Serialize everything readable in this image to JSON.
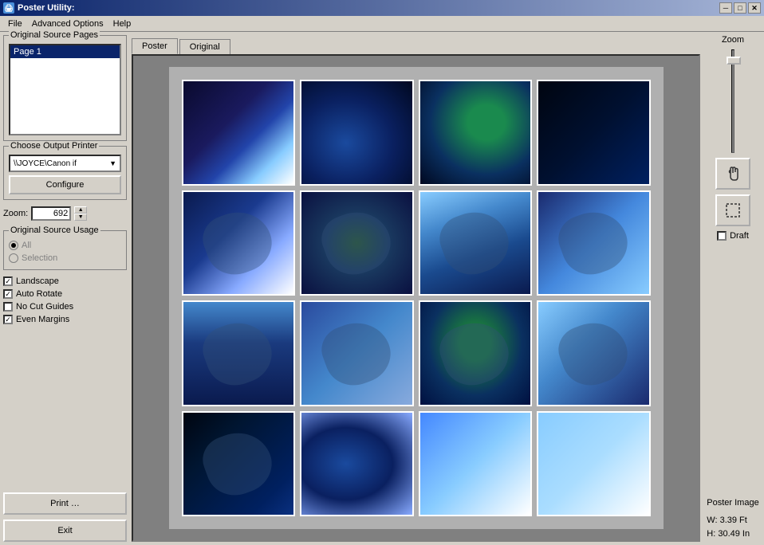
{
  "window": {
    "title": "Poster Utility:",
    "icon": "🖨"
  },
  "titlebar": {
    "minimize": "─",
    "maximize": "□",
    "close": "✕"
  },
  "menubar": {
    "items": [
      {
        "id": "file",
        "label": "File"
      },
      {
        "id": "advanced-options",
        "label": "Advanced Options"
      },
      {
        "id": "help",
        "label": "Help"
      }
    ]
  },
  "left_panel": {
    "source_pages_group": {
      "title": "Original Source Pages",
      "pages": [
        {
          "label": "Page 1",
          "selected": true
        }
      ]
    },
    "output_printer_group": {
      "title": "Choose Output Printer",
      "printer_value": "\\\\JOYCE\\Canon if",
      "configure_label": "Configure"
    },
    "zoom_row": {
      "label": "Zoom:",
      "value": "692"
    },
    "source_usage_group": {
      "title": "Original Source Usage",
      "options": [
        {
          "label": "All",
          "checked": true,
          "enabled": false
        },
        {
          "label": "Selection",
          "checked": false,
          "enabled": false
        }
      ]
    },
    "checkboxes": [
      {
        "id": "landscape",
        "label": "Landscape",
        "checked": true
      },
      {
        "id": "auto-rotate",
        "label": "Auto Rotate",
        "checked": true
      },
      {
        "id": "no-cut-guides",
        "label": "No Cut Guides",
        "checked": false
      },
      {
        "id": "even-margins",
        "label": "Even Margins",
        "checked": true
      }
    ],
    "print_label": "Print …",
    "exit_label": "Exit"
  },
  "tabs": [
    {
      "id": "poster",
      "label": "Poster",
      "active": true
    },
    {
      "id": "original",
      "label": "Original",
      "active": false
    }
  ],
  "right_panel": {
    "zoom_label": "Zoom",
    "draft_label": "Draft",
    "poster_image_label": "Poster Image",
    "width_label": "W: 3.39 Ft",
    "height_label": "H: 30.49 In"
  },
  "poster_grid": {
    "rows": 4,
    "cols": 4,
    "cells": [
      {
        "id": 1,
        "class": "img-1"
      },
      {
        "id": 2,
        "class": "img-2"
      },
      {
        "id": 3,
        "class": "img-3"
      },
      {
        "id": 4,
        "class": "img-4"
      },
      {
        "id": 5,
        "class": "img-5"
      },
      {
        "id": 6,
        "class": "img-6"
      },
      {
        "id": 7,
        "class": "img-7"
      },
      {
        "id": 8,
        "class": "img-8"
      },
      {
        "id": 9,
        "class": "img-9"
      },
      {
        "id": 10,
        "class": "img-10"
      },
      {
        "id": 11,
        "class": "img-11"
      },
      {
        "id": 12,
        "class": "img-12"
      },
      {
        "id": 13,
        "class": "img-13"
      },
      {
        "id": 14,
        "class": "img-14"
      },
      {
        "id": 15,
        "class": "img-15"
      },
      {
        "id": 16,
        "class": "img-16"
      }
    ]
  }
}
